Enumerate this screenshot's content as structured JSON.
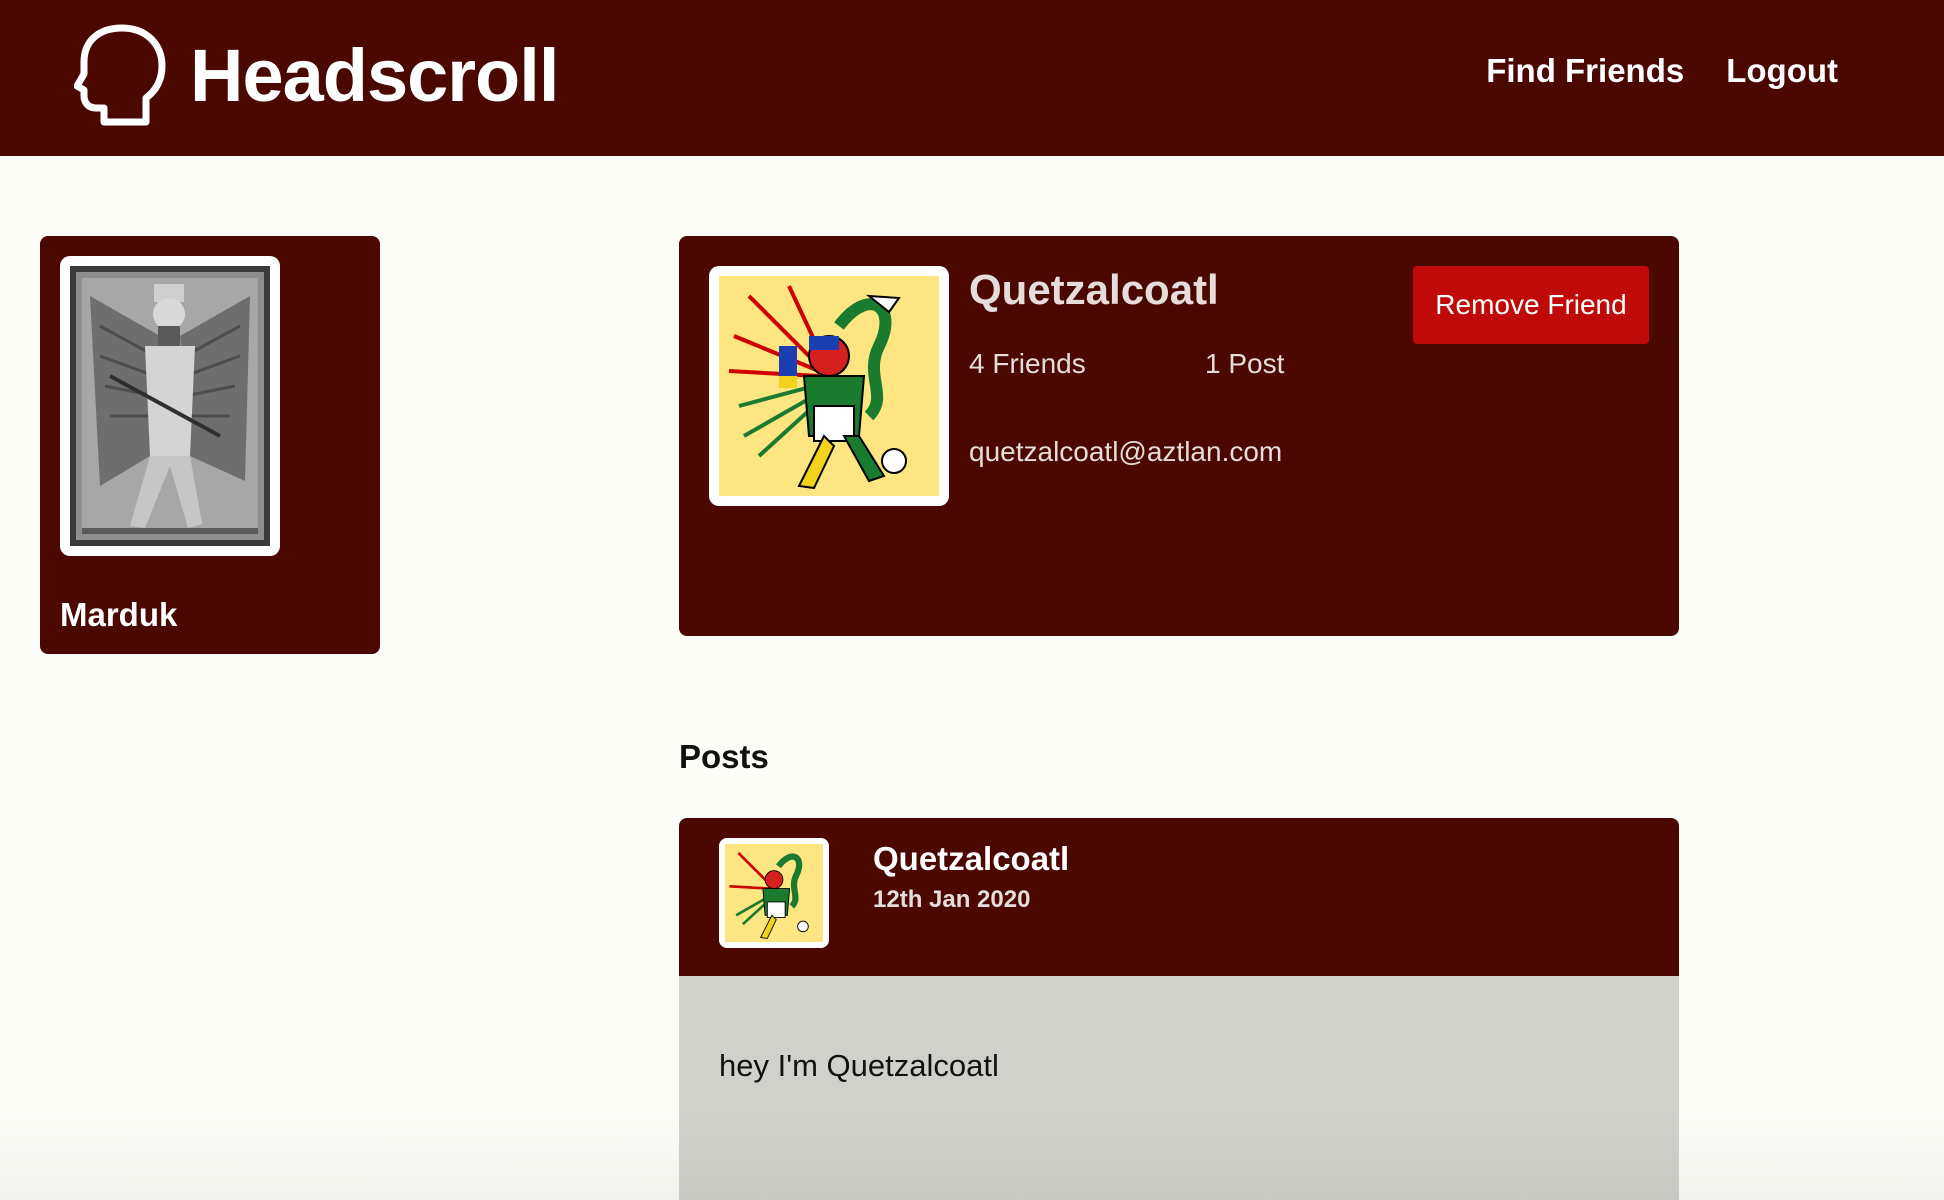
{
  "app": {
    "name": "Headscroll",
    "logo_icon": "head-outline-icon"
  },
  "nav": {
    "find_friends": "Find Friends",
    "logout": "Logout"
  },
  "colors": {
    "brand": "#4a0800",
    "danger": "#c00a0a",
    "post_body": "#d1d1cb",
    "page_bg": "#fdfdf8"
  },
  "sidebar": {
    "user_name": "Marduk"
  },
  "profile": {
    "name": "Quetzalcoatl",
    "friends": "4 Friends",
    "posts": "1 Post",
    "email": "quetzalcoatl@aztlan.com",
    "remove_label": "Remove Friend"
  },
  "posts_heading": "Posts",
  "posts": [
    {
      "author": "Quetzalcoatl",
      "date": "12th Jan 2020",
      "text": "hey I'm Quetzalcoatl"
    }
  ]
}
